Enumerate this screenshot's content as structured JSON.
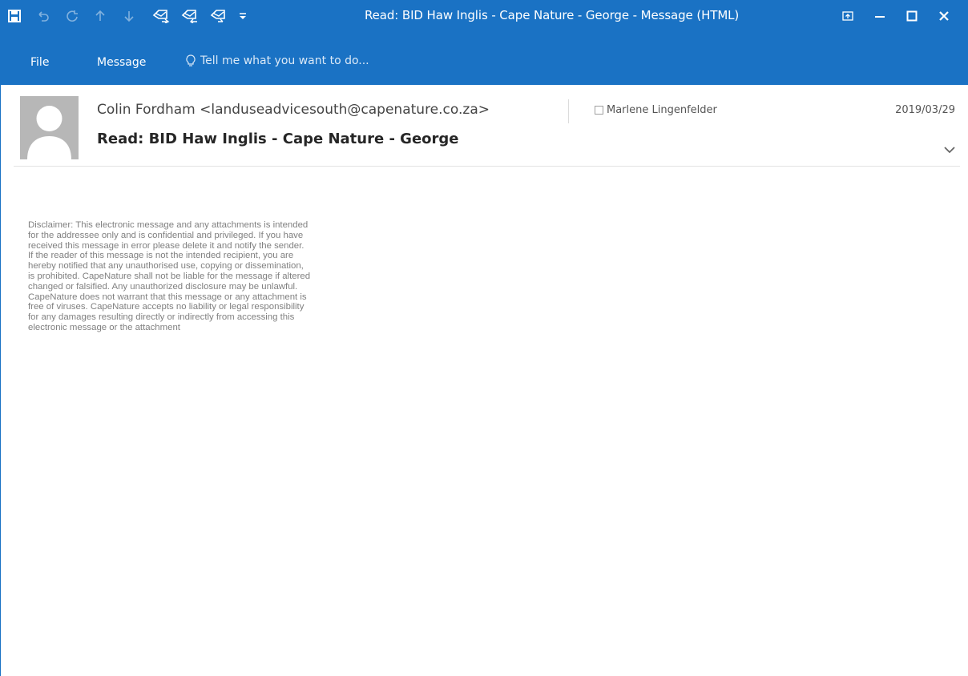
{
  "window": {
    "title": "Read: BID Haw Inglis - Cape Nature - George - Message (HTML)"
  },
  "quick_access": {
    "icons": [
      "save-icon",
      "undo-icon",
      "redo-icon",
      "previous-item-icon",
      "next-item-icon",
      "reply-icon",
      "reply-all-icon",
      "forward-icon",
      "customize-qat-icon"
    ]
  },
  "ribbon": {
    "tabs": [
      "File",
      "Message"
    ],
    "tell_me": "Tell me what you want to do..."
  },
  "message": {
    "sender": "Colin Fordham <landuseadvicesouth@capenature.co.za>",
    "recipient": "Marlene Lingenfelder",
    "date": "2019/03/29",
    "subject": "Read: BID Haw Inglis - Cape Nature - George",
    "body": "Disclaimer: This electronic message and any attachments is intended\nfor the addressee only and is confidential and privileged. If you have\nreceived this message in error please delete it and notify the sender.\nIf the reader of this message is not the intended recipient, you are\nhereby notified that any unauthorised use, copying or dissemination,\nis prohibited. CapeNature shall not be liable for the message if altered\nchanged or falsified. Any unauthorized disclosure may be unlawful.\nCapeNature does not warrant that this message or any attachment is\nfree of viruses. CapeNature accepts no liability or legal responsibility\nfor any damages resulting directly or indirectly from accessing this\nelectronic message or the attachment"
  },
  "colors": {
    "titlebar": "#1a72c4",
    "body_text": "#808080"
  }
}
